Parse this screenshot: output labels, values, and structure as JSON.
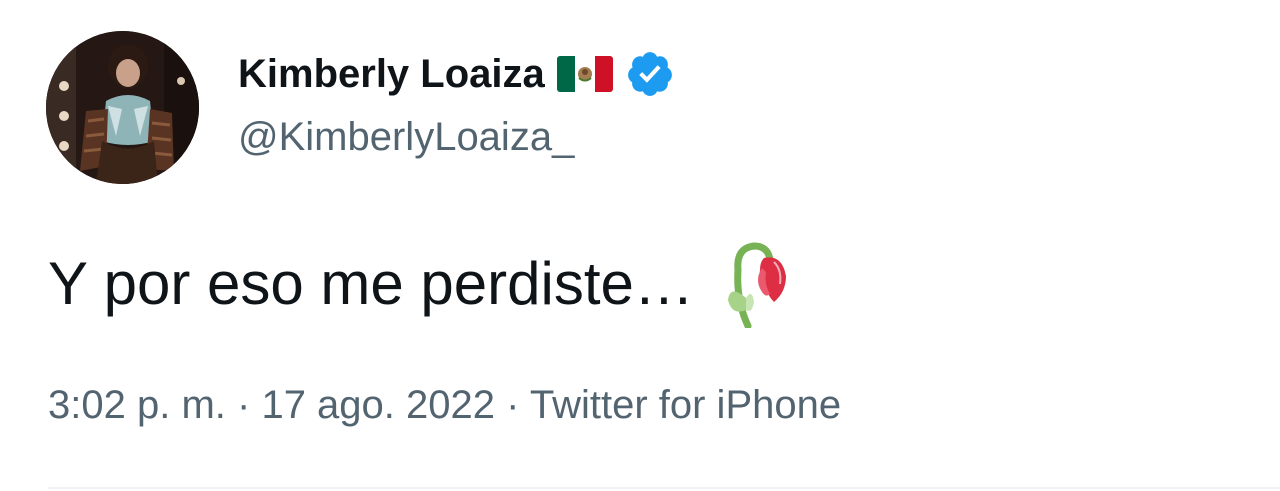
{
  "tweet": {
    "author": {
      "display_name": "Kimberly Loaiza",
      "handle": "@KimberlyLoaiza_",
      "flag_icon": "mexico-flag-icon",
      "verified_icon": "verified-badge-icon",
      "verified_color": "#1d9bf0"
    },
    "text": "Y por eso me perdiste…",
    "emoji_icon": "wilted-flower-icon",
    "meta": {
      "time": "3:02 p. m.",
      "separator": "·",
      "date": "17 ago. 2022",
      "source": "Twitter for iPhone"
    }
  },
  "colors": {
    "text_primary": "#0f1419",
    "text_secondary": "#536471",
    "divider": "#eff3f4"
  }
}
